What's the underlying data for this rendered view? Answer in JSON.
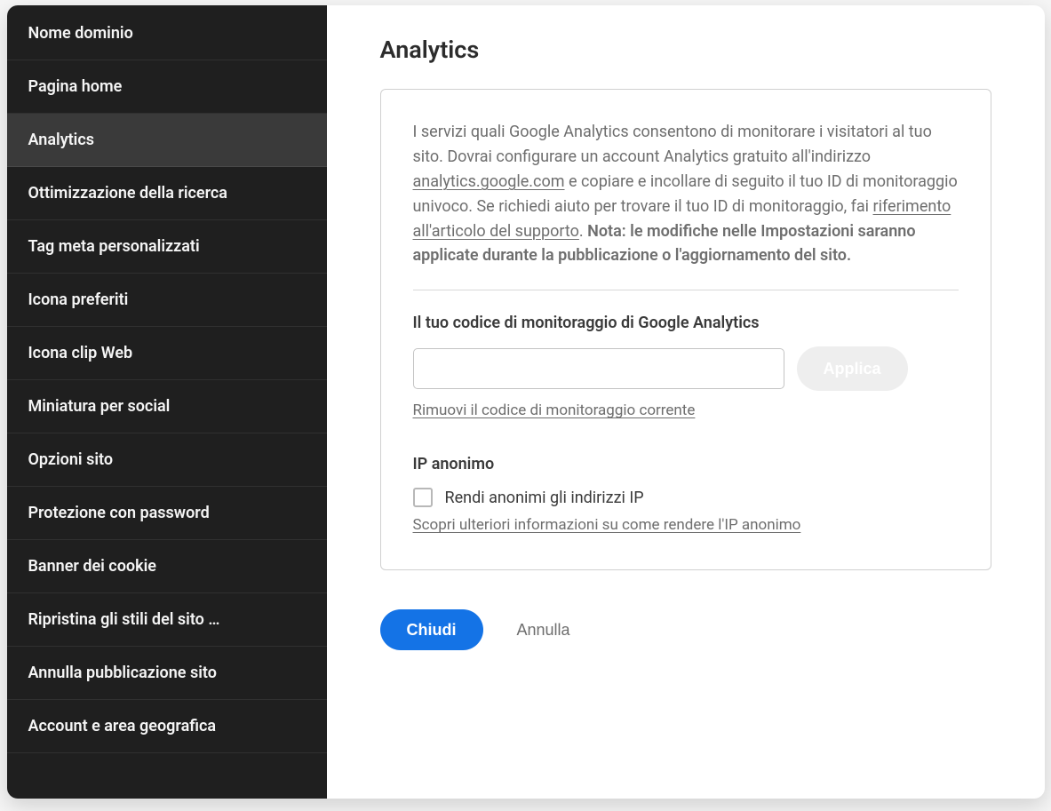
{
  "sidebar": {
    "items": [
      {
        "label": "Nome dominio",
        "active": false
      },
      {
        "label": "Pagina home",
        "active": false
      },
      {
        "label": "Analytics",
        "active": true
      },
      {
        "label": "Ottimizzazione della ricerca",
        "active": false
      },
      {
        "label": "Tag meta personalizzati",
        "active": false
      },
      {
        "label": "Icona preferiti",
        "active": false
      },
      {
        "label": "Icona clip Web",
        "active": false
      },
      {
        "label": "Miniatura per social",
        "active": false
      },
      {
        "label": "Opzioni sito",
        "active": false
      },
      {
        "label": "Protezione con password",
        "active": false
      },
      {
        "label": "Banner dei cookie",
        "active": false
      },
      {
        "label": "Ripristina gli stili del sito …",
        "active": false
      },
      {
        "label": "Annulla pubblicazione sito",
        "active": false
      },
      {
        "label": "Account e area geografica",
        "active": false
      }
    ]
  },
  "main": {
    "title": "Analytics",
    "description": {
      "part1": "I servizi quali Google Analytics consentono di monitorare i visitatori al tuo sito. Dovrai configurare un account Analytics gratuito all'indirizzo ",
      "link1": "analytics.google.com",
      "part2": " e copiare e incollare di seguito il tuo ID di monitoraggio univoco. Se richiedi aiuto per trovare il tuo ID di monitoraggio, fai ",
      "link2": "riferimento all'articolo del supporto",
      "part3": ". ",
      "note_label": "Nota: le modifiche nelle Impostazioni saranno applicate durante la pubblicazione o l'aggiornamento del sito."
    },
    "tracking": {
      "label": "Il tuo codice di monitoraggio di Google Analytics",
      "value": "",
      "apply_label": "Applica",
      "remove_label": "Rimuovi il codice di monitoraggio corrente"
    },
    "anon": {
      "title": "IP anonimo",
      "checkbox_label": "Rendi anonimi gli indirizzi IP",
      "checked": false,
      "learn_more": "Scopri ulteriori informazioni su come rendere l'IP anonimo"
    }
  },
  "footer": {
    "close_label": "Chiudi",
    "cancel_label": "Annulla"
  }
}
